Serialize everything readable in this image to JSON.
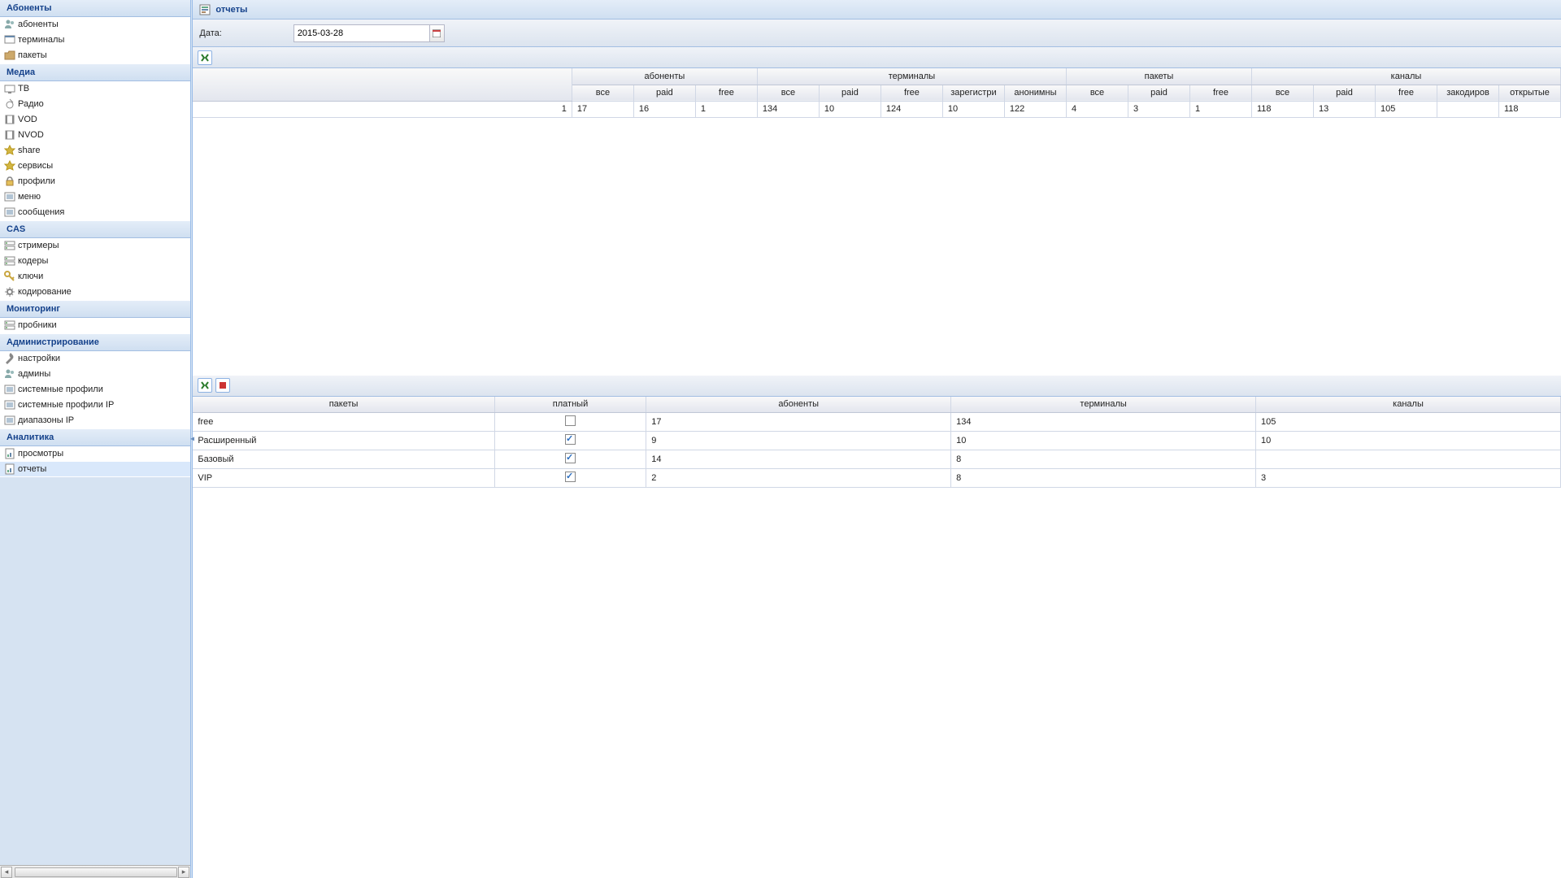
{
  "sidebar": {
    "sections": [
      {
        "title": "Абоненты",
        "items": [
          {
            "label": "абоненты",
            "icon": "users"
          },
          {
            "label": "терминалы",
            "icon": "terminal"
          },
          {
            "label": "пакеты",
            "icon": "folder"
          }
        ]
      },
      {
        "title": "Медиа",
        "items": [
          {
            "label": "ТВ",
            "icon": "tv"
          },
          {
            "label": "Радио",
            "icon": "radio"
          },
          {
            "label": "VOD",
            "icon": "film"
          },
          {
            "label": "NVOD",
            "icon": "film"
          },
          {
            "label": "share",
            "icon": "star"
          },
          {
            "label": "сервисы",
            "icon": "star"
          },
          {
            "label": "профили",
            "icon": "lock"
          },
          {
            "label": "меню",
            "icon": "list"
          },
          {
            "label": "сообщения",
            "icon": "list"
          }
        ]
      },
      {
        "title": "CAS",
        "items": [
          {
            "label": "стримеры",
            "icon": "server"
          },
          {
            "label": "кодеры",
            "icon": "server"
          },
          {
            "label": "ключи",
            "icon": "key"
          },
          {
            "label": "кодирование",
            "icon": "gear"
          }
        ]
      },
      {
        "title": "Мониторинг",
        "items": [
          {
            "label": "пробники",
            "icon": "server"
          }
        ]
      },
      {
        "title": "Администрирование",
        "items": [
          {
            "label": "настройки",
            "icon": "wrench"
          },
          {
            "label": "админы",
            "icon": "users"
          },
          {
            "label": "системные профили",
            "icon": "list"
          },
          {
            "label": "системные профили IP",
            "icon": "list"
          },
          {
            "label": "диапазоны IP",
            "icon": "list"
          }
        ]
      },
      {
        "title": "Аналитика",
        "items": [
          {
            "label": "просмотры",
            "icon": "report"
          },
          {
            "label": "отчеты",
            "icon": "report",
            "active": true
          }
        ]
      }
    ]
  },
  "header": {
    "title": "отчеты"
  },
  "filter": {
    "date_label": "Дата:",
    "date_value": "2015-03-28"
  },
  "top_grid": {
    "group_headers": [
      "абоненты",
      "терминалы",
      "пакеты",
      "каналы"
    ],
    "sub_headers_g1": [
      "все",
      "paid",
      "free"
    ],
    "sub_headers_g2": [
      "все",
      "paid",
      "free",
      "зарегистри",
      "анонимны"
    ],
    "sub_headers_g3": [
      "все",
      "paid",
      "free"
    ],
    "sub_headers_g4": [
      "все",
      "paid",
      "free",
      "закодиров",
      "открытые"
    ],
    "row": {
      "num": "1",
      "cells": [
        "17",
        "16",
        "1",
        "134",
        "10",
        "124",
        "10",
        "122",
        "4",
        "3",
        "1",
        "118",
        "13",
        "105",
        "",
        "118"
      ]
    }
  },
  "bottom_grid": {
    "headers": [
      "пакеты",
      "платный",
      "абоненты",
      "терминалы",
      "каналы"
    ],
    "rows": [
      {
        "c0": "free",
        "paid": false,
        "c2": "17",
        "c3": "134",
        "c4": "105"
      },
      {
        "c0": "Расширенный",
        "paid": true,
        "c2": "9",
        "c3": "10",
        "c4": "10"
      },
      {
        "c0": "Базовый",
        "paid": true,
        "c2": "14",
        "c3": "8",
        "c4": ""
      },
      {
        "c0": "VIP",
        "paid": true,
        "c2": "2",
        "c3": "8",
        "c4": "3"
      }
    ]
  }
}
